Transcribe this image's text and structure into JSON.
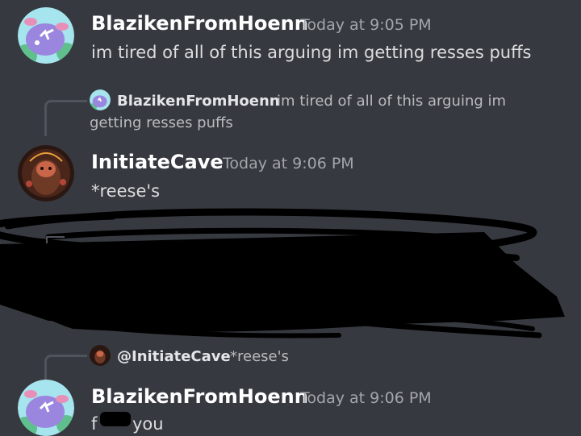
{
  "messages": [
    {
      "author": "BlazikenFromHoenn",
      "timestamp": "Today at 9:05 PM",
      "text": "im tired of all of this arguing im getting resses puffs"
    },
    {
      "reply_to": {
        "author": "BlazikenFromHoenn",
        "text_line1": "im tired of all of this arguing im",
        "text_line2": "getting resses puffs"
      },
      "author": "InitiateCave",
      "timestamp": "Today at 9:06 PM",
      "text": "*reese's"
    },
    {
      "reply_to": {
        "author": "@InitiateCave",
        "text": "*reese's"
      },
      "author": "BlazikenFromHoenn",
      "timestamp": "Today at 9:06 PM",
      "text_start": "f",
      "text_end": "you"
    }
  ],
  "colors": {
    "background": "#36393f",
    "username": "#ffffff",
    "timestamp": "#a3a6aa",
    "message_text": "#dcddde",
    "reply_spine": "#4f545c",
    "scribble": "#000000"
  },
  "icons": {
    "blaziken_avatar": "pink-creature-avatar",
    "initiate_avatar": "hooded-figure-avatar"
  }
}
